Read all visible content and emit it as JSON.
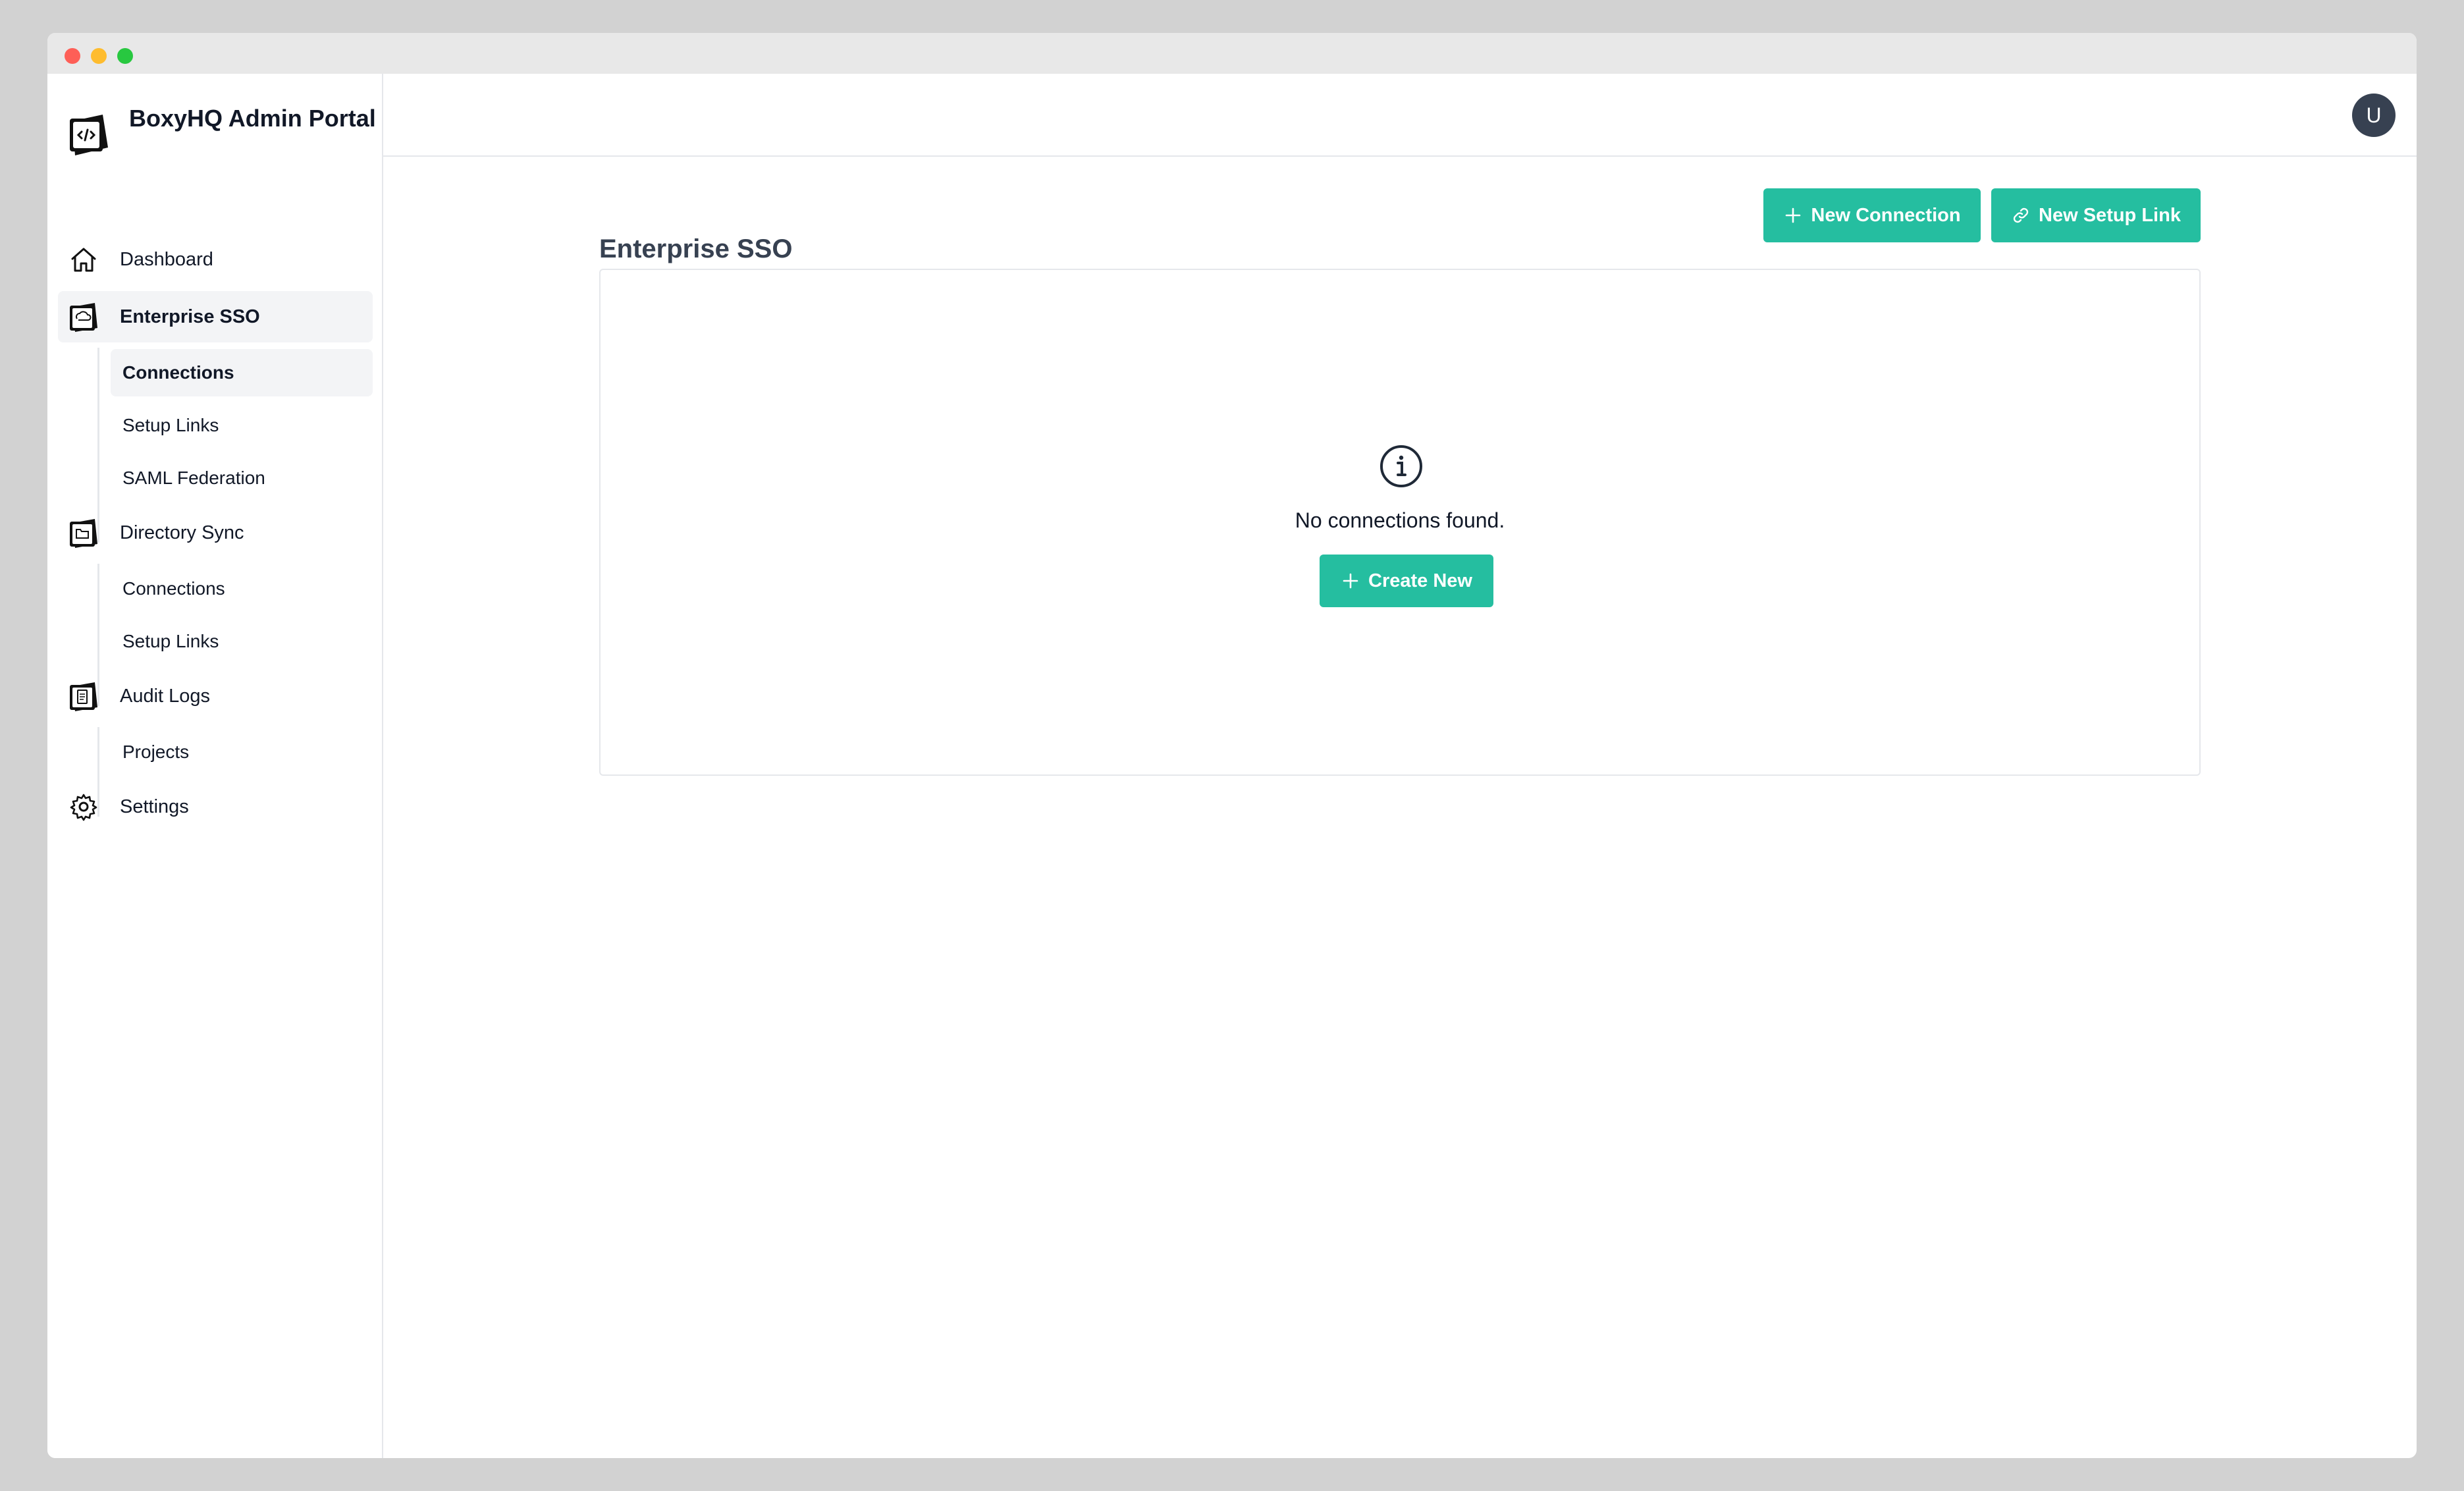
{
  "brand": {
    "title": "BoxyHQ Admin Portal"
  },
  "nav": {
    "dashboard": "Dashboard",
    "enterprise_sso": "Enterprise SSO",
    "sso_sub": [
      "Connections",
      "Setup Links",
      "SAML Federation"
    ],
    "directory_sync": "Directory Sync",
    "dsync_sub": [
      "Connections",
      "Setup Links"
    ],
    "audit_logs": "Audit Logs",
    "audit_sub": [
      "Projects"
    ],
    "settings": "Settings"
  },
  "header": {
    "avatar_initial": "U"
  },
  "main": {
    "title": "Enterprise SSO",
    "new_connection_label": "New Connection",
    "new_setup_link_label": "New Setup Link",
    "empty_message": "No connections found.",
    "create_new_label": "Create New"
  },
  "colors": {
    "accent": "#25bea0",
    "active_bg": "#f3f4f6",
    "avatar_bg": "#374151"
  }
}
